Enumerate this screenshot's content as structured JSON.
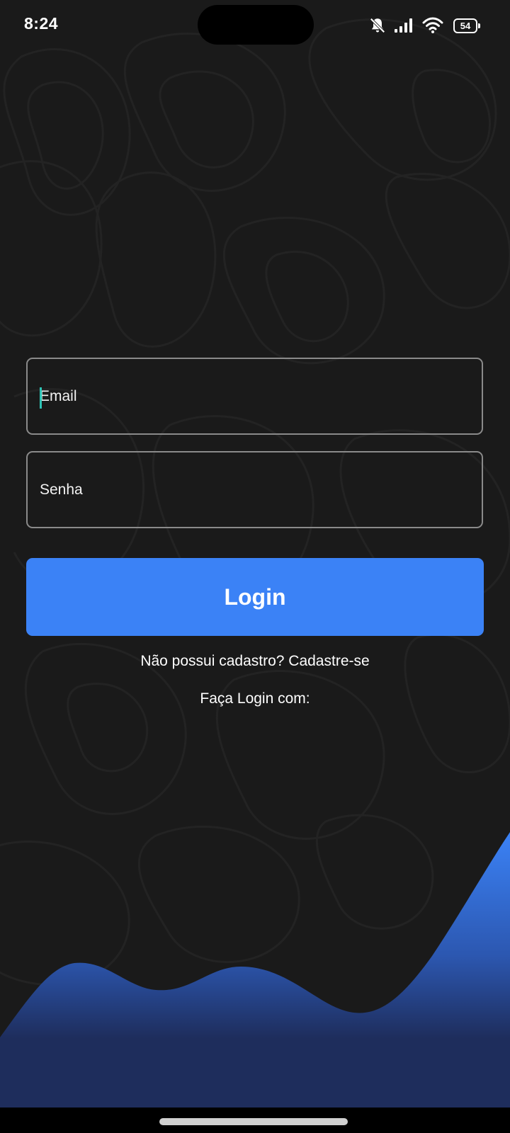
{
  "status_bar": {
    "time": "8:24",
    "battery_level": "54",
    "icons": [
      "bell-muted-icon",
      "signal-icon",
      "wifi-icon",
      "battery-icon"
    ]
  },
  "login_form": {
    "email_placeholder": "Email",
    "email_value": "",
    "password_placeholder": "Senha",
    "password_value": "",
    "login_label": "Login"
  },
  "register": {
    "text": "Não possui cadastro? Cadastre-se"
  },
  "social": {
    "label": "Faça Login com:"
  },
  "colors": {
    "background": "#1a1a1a",
    "accent": "#3b82f6",
    "wave_dark": "#1e2d5c",
    "cursor": "#2ec4b6"
  }
}
